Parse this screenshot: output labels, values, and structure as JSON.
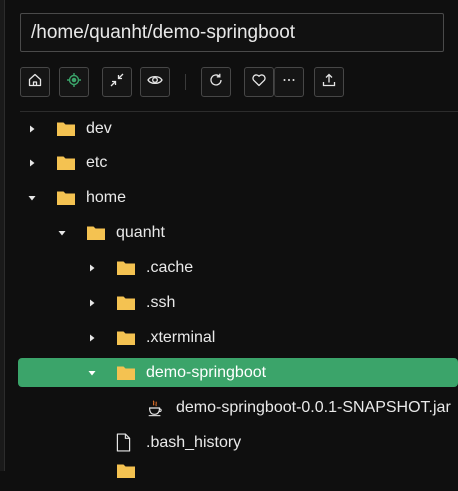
{
  "path_input": {
    "value": "/home/quanht/demo-springboot"
  },
  "toolbar": {
    "buttons": [
      {
        "name": "home-button",
        "icon": "home-icon"
      },
      {
        "name": "locate-button",
        "icon": "crosshair-icon",
        "color": "#3ba46a"
      },
      {
        "name": "collapse-button",
        "icon": "collapse-arrows-icon"
      },
      {
        "name": "toggle-hidden-button",
        "icon": "eye-icon"
      },
      {
        "name": "refresh-button",
        "icon": "refresh-icon"
      },
      {
        "name": "favorite-button",
        "icon": "heart-icon"
      },
      {
        "name": "more-button",
        "icon": "ellipsis-icon"
      },
      {
        "name": "upload-button",
        "icon": "upload-icon"
      }
    ]
  },
  "tree": {
    "selected_color": "#3ba46a",
    "folder_color": "#f4c251",
    "items": [
      {
        "label": "dev",
        "kind": "folder",
        "state": "collapsed"
      },
      {
        "label": "etc",
        "kind": "folder",
        "state": "collapsed"
      },
      {
        "label": "home",
        "kind": "folder",
        "state": "expanded"
      },
      {
        "label": "quanht",
        "kind": "folder",
        "state": "expanded"
      },
      {
        "label": ".cache",
        "kind": "folder",
        "state": "collapsed"
      },
      {
        "label": ".ssh",
        "kind": "folder",
        "state": "collapsed"
      },
      {
        "label": ".xterminal",
        "kind": "folder",
        "state": "collapsed"
      },
      {
        "label": "demo-springboot",
        "kind": "folder",
        "state": "expanded",
        "selected": true
      },
      {
        "label": "demo-springboot-0.0.1-SNAPSHOT.jar",
        "kind": "java-file"
      },
      {
        "label": ".bash_history",
        "kind": "file"
      },
      {
        "label": "",
        "kind": "folder"
      }
    ]
  }
}
